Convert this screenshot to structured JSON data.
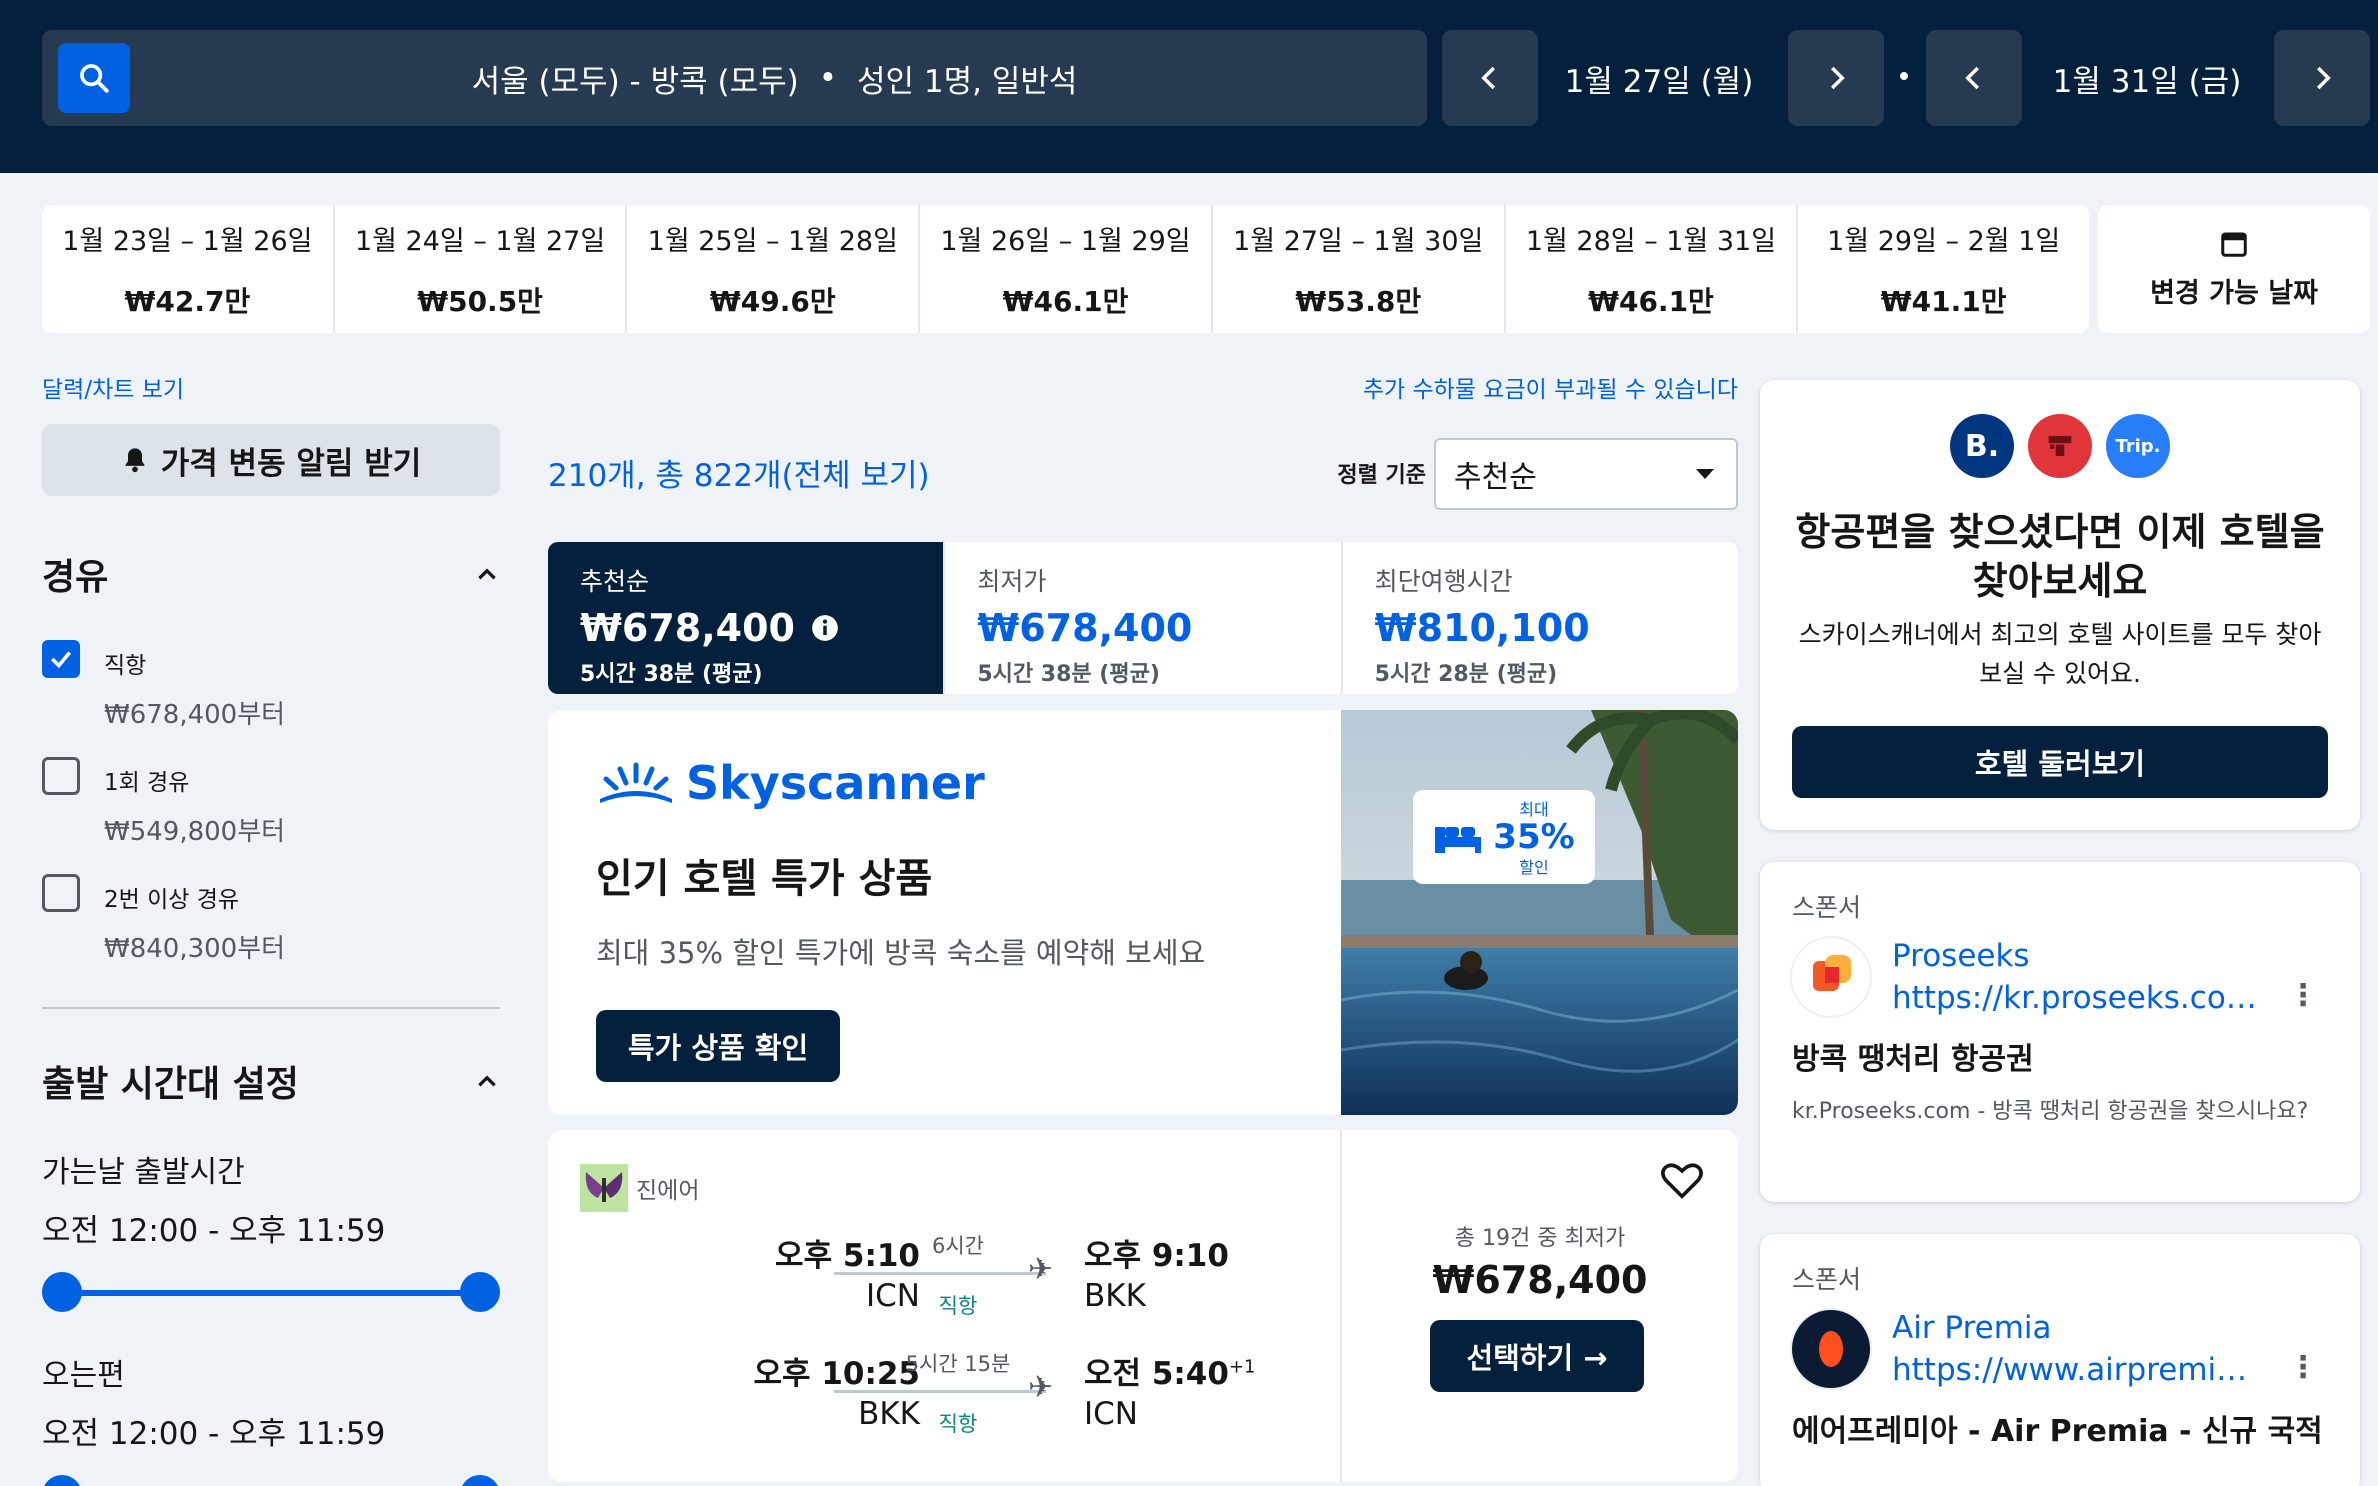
{
  "header": {
    "search_summary": "서울 (모두) - 방콕 (모두)",
    "separator": "•",
    "passengers": "성인 1명, 일반석",
    "depart_date": "1월 27일 (월)",
    "return_date": "1월 31일 (금)",
    "dot": "•"
  },
  "date_strip": [
    {
      "range": "1월 23일 – 1월 26일",
      "price": "₩42.7만"
    },
    {
      "range": "1월 24일 – 1월 27일",
      "price": "₩50.5만"
    },
    {
      "range": "1월 25일 – 1월 28일",
      "price": "₩49.6만"
    },
    {
      "range": "1월 26일 – 1월 29일",
      "price": "₩46.1만"
    },
    {
      "range": "1월 27일 – 1월 30일",
      "price": "₩53.8만"
    },
    {
      "range": "1월 28일 – 1월 31일",
      "price": "₩46.1만"
    },
    {
      "range": "1월 29일 – 2월 1일",
      "price": "₩41.1만"
    }
  ],
  "flexible_dates_label": "변경 가능 날짜",
  "sidebar": {
    "calendar_link": "달력/차트 보기",
    "price_alert": "가격 변동 알림 받기",
    "stops_title": "경유",
    "stops": [
      {
        "label": "직항",
        "price": "₩678,400부터",
        "checked": true
      },
      {
        "label": "1회 경유",
        "price": "₩549,800부터",
        "checked": false
      },
      {
        "label": "2번 이상 경유",
        "price": "₩840,300부터",
        "checked": false
      }
    ],
    "times_title": "출발 시간대 설정",
    "outbound_label": "가는날 출발시간",
    "outbound_range": "오전 12:00 - 오후 11:59",
    "return_label": "오는편",
    "return_range": "오전 12:00 - 오후 11:59"
  },
  "results": {
    "fee_note": "추가 수하물 요금이 부과될 수 있습니다",
    "count": "210개, 총 822개(전체 보기)",
    "sort_label": "정렬 기준",
    "sort_value": "추천순",
    "tabs": [
      {
        "name": "추천순",
        "price": "₩678,400",
        "duration": "5시간 38분 (평균)"
      },
      {
        "name": "최저가",
        "price": "₩678,400",
        "duration": "5시간 38분 (평균)"
      },
      {
        "name": "최단여행시간",
        "price": "₩810,100",
        "duration": "5시간 28분 (평균)"
      }
    ]
  },
  "promo": {
    "brand": "Skyscanner",
    "title": "인기 호텔 특가 상품",
    "desc": "최대 35% 할인 특가에 방콕 숙소를 예약해 보세요",
    "button": "특가 상품 확인",
    "badge_top": "최대",
    "badge_pct": "35%",
    "badge_bottom": "할인"
  },
  "flight": {
    "airline": "진에어",
    "outbound": {
      "depart_time": "오후 5:10",
      "depart_code": "ICN",
      "duration": "6시간",
      "stops": "직항",
      "arrive_time": "오후 9:10",
      "arrive_code": "BKK"
    },
    "inbound": {
      "depart_time": "오후 10:25",
      "depart_code": "BKK",
      "duration": "5시간 15분",
      "stops": "직항",
      "arrive_time": "오전 5:40",
      "arrive_sup": "+1",
      "arrive_code": "ICN"
    },
    "deal_count": "총 19건 중 최저가",
    "price": "₩678,400",
    "select": "선택하기 →"
  },
  "hotel_ad": {
    "logo_b": "B.",
    "logo_trip": "Trip.",
    "title": "항공편을 찾으셨다면 이제 호텔을 찾아보세요",
    "desc": "스카이스캐너에서 최고의 호텔 사이트를 모두 찾아보실 수 있어요.",
    "button": "호텔 둘러보기"
  },
  "sponsors": [
    {
      "label": "스폰서",
      "name": "Proseeks",
      "url": "https://kr.proseeks.com...",
      "title": "방콕 땡처리 항공권",
      "desc": "kr.Proseeks.com - 방콕 땡처리 항공권을 찾으시나요?"
    },
    {
      "label": "스폰서",
      "name": "Air Premia",
      "url": "https://www.airpremia.c...",
      "title": "에어프레미아 - Air Premia - 신규 국적"
    }
  ],
  "colors": {
    "navy": "#05203c",
    "blue": "#0062e3",
    "bg": "#eff3f8"
  }
}
